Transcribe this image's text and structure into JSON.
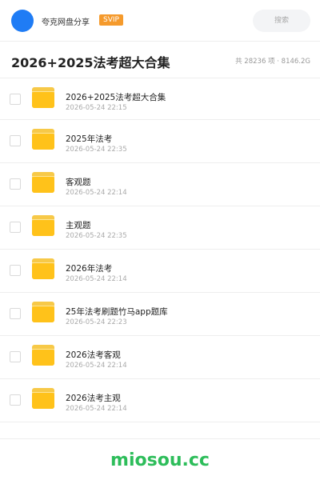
{
  "header": {
    "user_name": "夸克网盘分享",
    "badge": "SVIP",
    "search_label": "搜索",
    "avatar_color": "#1f7cf5",
    "badge_color": "#f59a2c"
  },
  "title_bar": {
    "title": "2026+2025法考超大合集",
    "stats": "共 28236 项 · 8146.2G"
  },
  "items": [
    {
      "name": "2026+2025法考超大合集",
      "date": "2026-05-24 22:15",
      "icon": "folder-icon"
    },
    {
      "name": "2025年法考",
      "date": "2026-05-24 22:35",
      "icon": "folder-icon"
    },
    {
      "name": "客观题",
      "date": "2026-05-24 22:14",
      "icon": "folder-icon"
    },
    {
      "name": "主观题",
      "date": "2026-05-24 22:35",
      "icon": "folder-icon"
    },
    {
      "name": "2026年法考",
      "date": "2026-05-24 22:14",
      "icon": "folder-icon"
    },
    {
      "name": "25年法考刷题竹马app题库",
      "date": "2026-05-24 22:23",
      "icon": "folder-icon"
    },
    {
      "name": "2026法考客观",
      "date": "2026-05-24 22:14",
      "icon": "folder-icon"
    },
    {
      "name": "2026法考主观",
      "date": "2026-05-24 22:14",
      "icon": "folder-icon"
    }
  ],
  "footer": {
    "logo_text": "miosou.cc",
    "logo_color": "#2dbd5a"
  }
}
